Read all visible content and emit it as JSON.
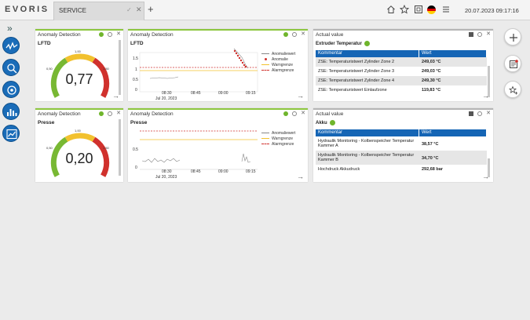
{
  "app": {
    "logo": "EVORIS",
    "datetime": "20.07.2023 09:17:16"
  },
  "tabs": [
    {
      "label": "SERVICE"
    }
  ],
  "icons": {
    "home": "home-icon",
    "star": "star-icon",
    "fullscreen": "fullscreen-icon",
    "flag": "german-flag-icon",
    "menu": "menu-icon"
  },
  "sidebar": {
    "toggle": "»"
  },
  "colors": {
    "accent": "#8dc63f",
    "primary": "#1565b5",
    "ok": "#6fb52c",
    "alarm": "#d0312d",
    "warn": "#f2c12e"
  },
  "widgets": {
    "gauge1": {
      "title": "Anomaly Detection",
      "subtitle": "LFTD",
      "value": "0,77",
      "scale": {
        "low": "0,50",
        "mid": "1,00",
        "high": "1,50"
      }
    },
    "chart1": {
      "title": "Anomaly Detection",
      "subtitle": "LFTD",
      "yticks": [
        "1.5",
        "1",
        "0.5",
        "0"
      ],
      "xticks": [
        "08:30",
        "08:45",
        "09:00",
        "09:15"
      ],
      "date": "Jul 20, 2023",
      "legend": [
        "Anomaliewert",
        "Anomalie",
        "Warngrenze",
        "Alarmgrenze"
      ]
    },
    "table1": {
      "title": "Actual value",
      "subtitle": "Extruder Temperatur",
      "columns": [
        "Kommentar",
        "Wert"
      ],
      "rows": [
        {
          "label": "ZSE: Temperaturistwert Zylinder Zone 2",
          "value": "249,03 °C"
        },
        {
          "label": "ZSE: Temperaturistwert Zylinder Zone 3",
          "value": "249,03 °C"
        },
        {
          "label": "ZSE: Temperaturistwert Zylinder Zone 4",
          "value": "249,30 °C"
        },
        {
          "label": "ZSE: Temperaturistwert Einlaufzone",
          "value": "119,83 °C"
        }
      ]
    },
    "gauge2": {
      "title": "Anomaly Detection",
      "subtitle": "Presse",
      "value": "0,20",
      "scale": {
        "low": "0,50",
        "mid": "1,00",
        "high": "1,50"
      }
    },
    "chart2": {
      "title": "Anomaly Detection",
      "subtitle": "Presse",
      "yticks": [
        "0.5",
        "0"
      ],
      "xticks": [
        "08:30",
        "08:45",
        "09:00",
        "09:15"
      ],
      "date": "Jul 20, 2023",
      "legend": [
        "Anomaliewert",
        "Warngrenze",
        "Alarmgrenze"
      ]
    },
    "table2": {
      "title": "Actual value",
      "subtitle": "Akku",
      "columns": [
        "Kommentar",
        "Wert"
      ],
      "rows": [
        {
          "label": "Hydraulik Monitoring - Kolbenspeicher Temperatur Kammer A",
          "value": "38,57 °C"
        },
        {
          "label": "Hydraulik Monitoring - Kolbenspeicher Temperatur Kammer B",
          "value": "34,70 °C"
        },
        {
          "label": "Hochdruck Akkudruck",
          "value": "292,68 bar"
        }
      ]
    }
  }
}
